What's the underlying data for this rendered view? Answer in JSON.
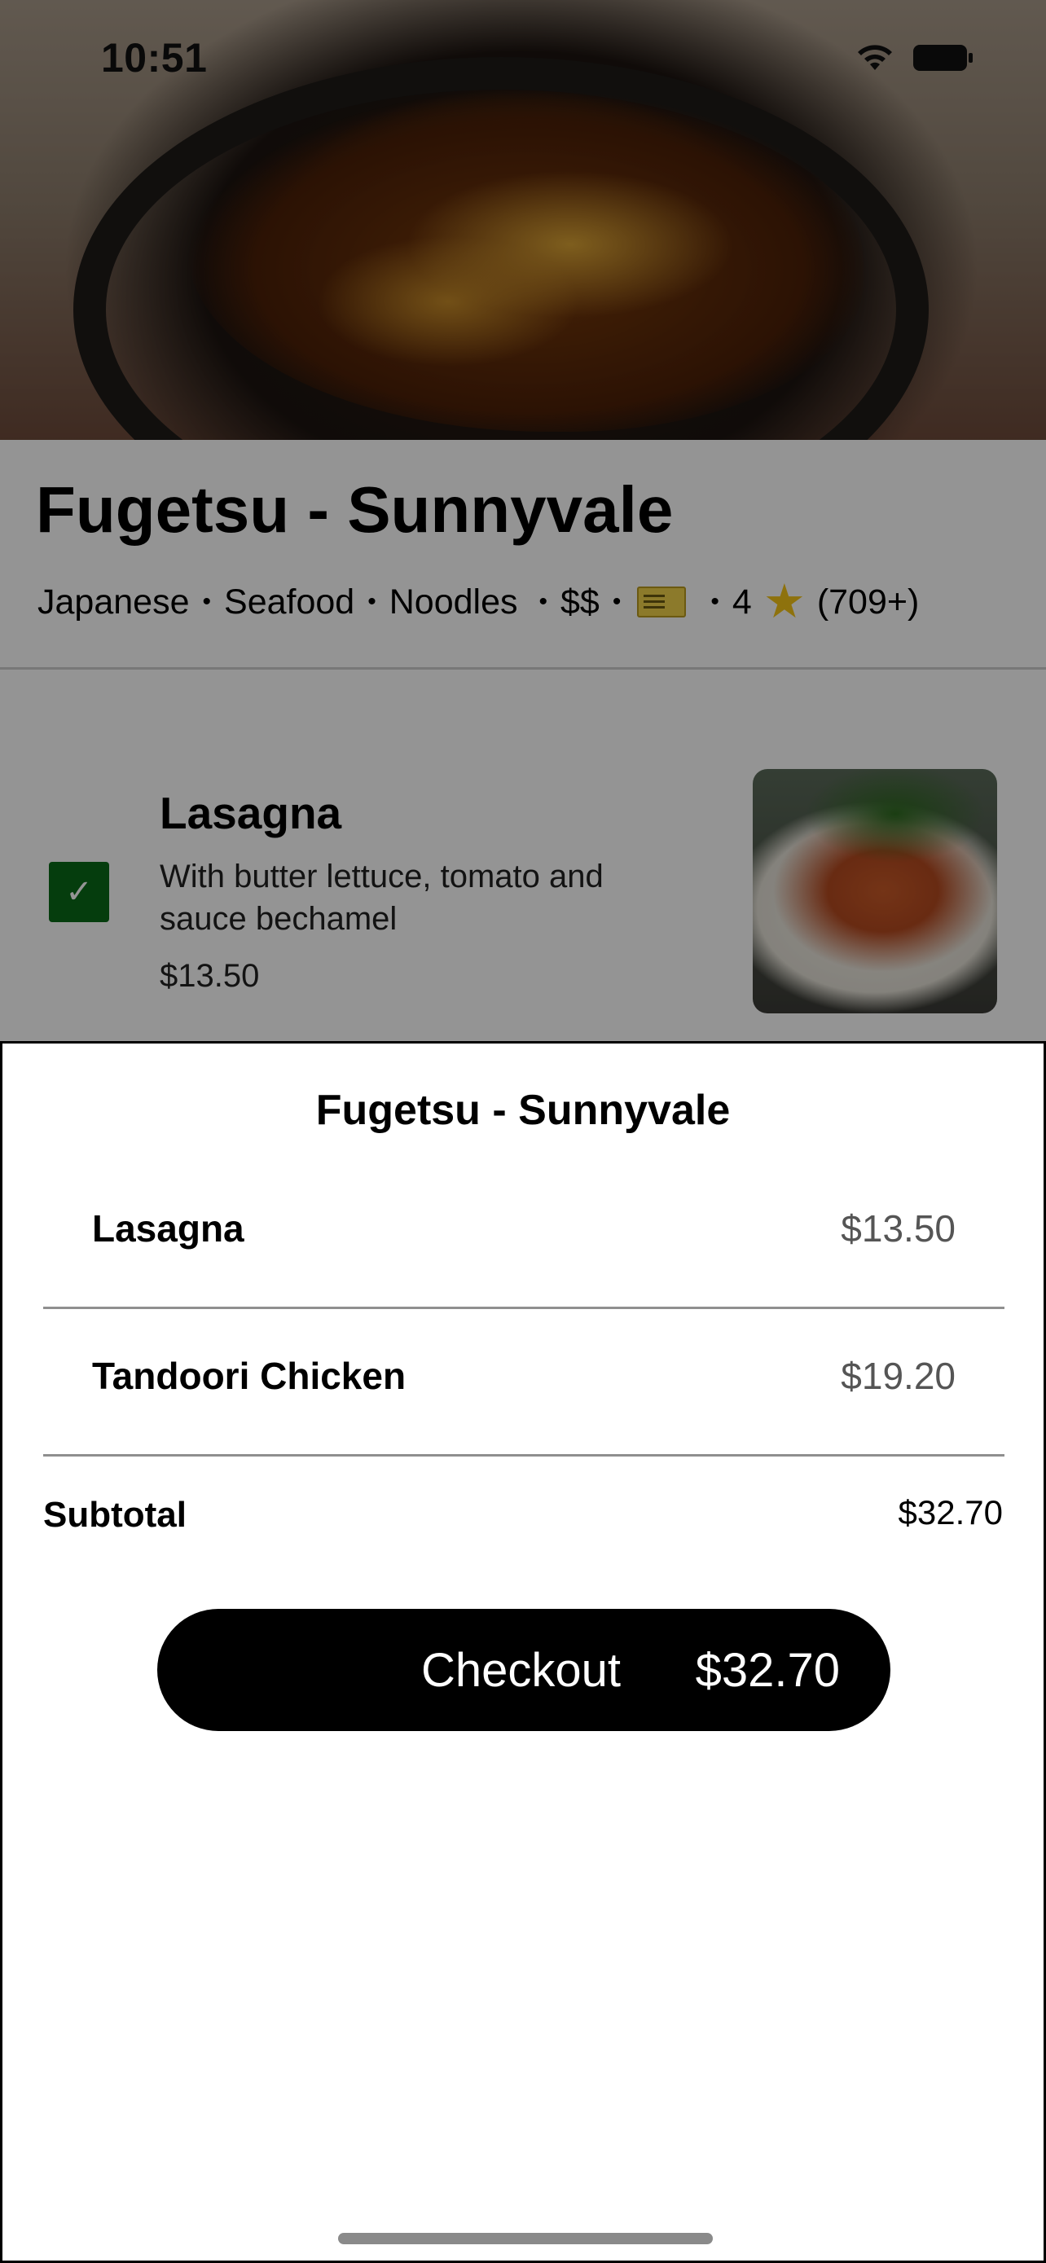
{
  "status_bar": {
    "time": "10:51"
  },
  "restaurant": {
    "name": "Fugetsu - Sunnyvale",
    "cuisines": [
      "Japanese",
      "Seafood",
      "Noodles"
    ],
    "price_level": "$$",
    "rating": "4",
    "review_count": "(709+)"
  },
  "menu_item": {
    "name": "Lasagna",
    "description": "With butter lettuce, tomato and sauce bechamel",
    "price": "$13.50",
    "selected": true
  },
  "cart": {
    "title": "Fugetsu - Sunnyvale",
    "items": [
      {
        "name": "Lasagna",
        "price": "$13.50"
      },
      {
        "name": "Tandoori Chicken",
        "price": "$19.20"
      }
    ],
    "subtotal_label": "Subtotal",
    "subtotal_value": "$32.70",
    "checkout_label": "Checkout",
    "checkout_total": "$32.70"
  },
  "icons": {
    "status": [
      "wifi-icon",
      "battery-icon"
    ],
    "meta": [
      "ticket-icon",
      "star-icon"
    ],
    "check": "checkmark-icon"
  },
  "colors": {
    "checkbox": "#0a6a18",
    "checkout_button": "#000000",
    "star": "#f5c518"
  }
}
